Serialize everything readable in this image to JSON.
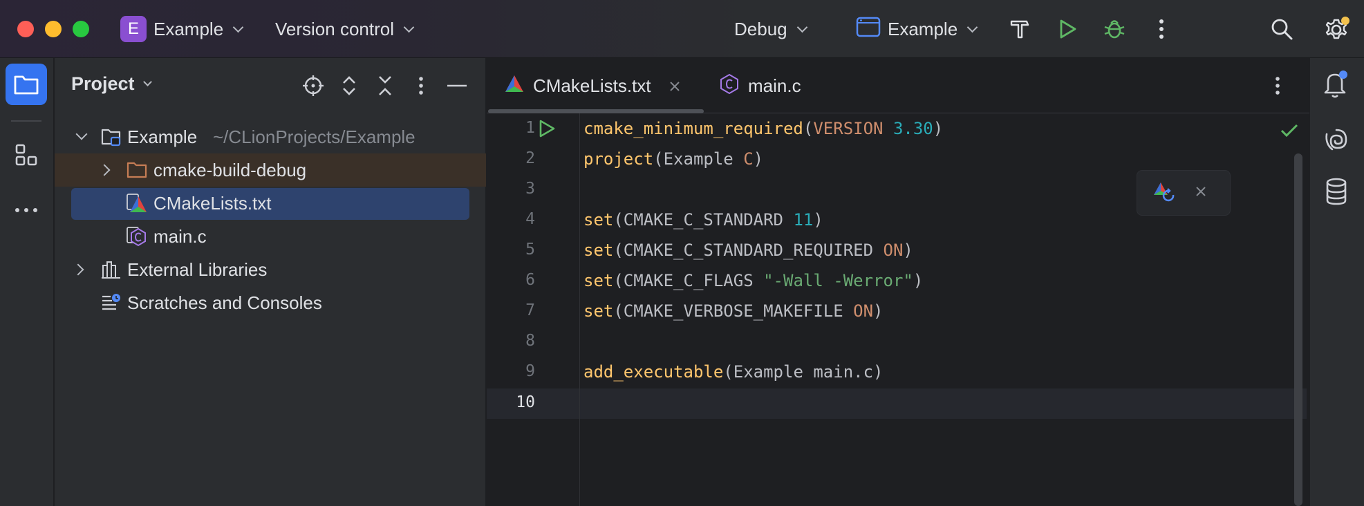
{
  "titlebar": {
    "project_badge": "E",
    "project_name": "Example",
    "version_control": "Version control",
    "run_config_mode": "Debug",
    "run_target": "Example",
    "icons": [
      "hammer-icon",
      "run-icon",
      "debug-icon",
      "more-icon",
      "search-icon",
      "settings-icon"
    ]
  },
  "left_strip": {
    "items": [
      "project-icon",
      "structure-icon",
      "more-tools-icon"
    ]
  },
  "project_panel": {
    "title": "Project",
    "tree": [
      {
        "label": "Example",
        "path": "~/CLionProjects/Example",
        "type": "root-folder",
        "expanded": true
      },
      {
        "label": "cmake-build-debug",
        "type": "build-folder",
        "expanded": false
      },
      {
        "label": "CMakeLists.txt",
        "type": "cmake-file",
        "selected": true
      },
      {
        "label": "main.c",
        "type": "c-file"
      },
      {
        "label": "External Libraries",
        "type": "libraries",
        "expanded": false
      },
      {
        "label": "Scratches and Consoles",
        "type": "scratches"
      }
    ]
  },
  "editor": {
    "tabs": [
      {
        "label": "CMakeLists.txt",
        "active": true
      },
      {
        "label": "main.c",
        "active": false
      }
    ],
    "line_numbers": [
      "1",
      "2",
      "3",
      "4",
      "5",
      "6",
      "7",
      "8",
      "9",
      "10"
    ],
    "code": {
      "l1_fn": "cmake_minimum_required",
      "l1_open": "(",
      "l1_kw": "VERSION",
      "l1_sp": " ",
      "l1_num": "3.30",
      "l1_close": ")",
      "l2_fn": "project",
      "l2_open": "(Example ",
      "l2_c": "C",
      "l2_close": ")",
      "l4_fn": "set",
      "l4_open": "(CMAKE_C_STANDARD ",
      "l4_num": "11",
      "l4_close": ")",
      "l5_fn": "set",
      "l5_open": "(CMAKE_C_STANDARD_REQUIRED ",
      "l5_on": "ON",
      "l5_close": ")",
      "l6_fn": "set",
      "l6_open": "(CMAKE_C_FLAGS ",
      "l6_str": "\"-Wall -Werror\"",
      "l6_close": ")",
      "l7_fn": "set",
      "l7_open": "(CMAKE_VERBOSE_MAKEFILE ",
      "l7_on": "ON",
      "l7_close": ")",
      "l9_fn": "add_executable",
      "l9_args": "(Example main.c)"
    },
    "current_line": 10
  },
  "colors": {
    "accent": "#3574f0",
    "run_green": "#5fb865",
    "keyword_gold": "#ffc66d",
    "number_teal": "#2aacb8",
    "constant_orange": "#cf8e6d",
    "string_green": "#6aab73"
  },
  "right_strip": {
    "items": [
      "notifications-icon",
      "ai-assistant-icon",
      "database-icon"
    ]
  }
}
